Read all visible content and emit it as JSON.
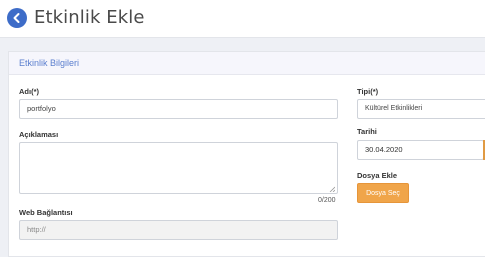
{
  "header": {
    "title": "Etkinlik Ekle",
    "back_icon": "arrow-left-circle-icon"
  },
  "card": {
    "title": "Etkinlik Bilgileri"
  },
  "form": {
    "name_label": "Adı(*)",
    "name_value": "portfolyo",
    "description_label": "Açıklaması",
    "description_value": "",
    "char_counter": "0/200",
    "web_label": "Web Bağlantısı",
    "web_placeholder": "http://",
    "type_label": "Tipi(*)",
    "type_value": "Kültürel Etkinlikleri",
    "date_label": "Tarihi",
    "date_value": "30.04.2020",
    "file_label": "Dosya Ekle",
    "file_button": "Dosya Seç"
  },
  "colors": {
    "accent_blue": "#3d6cc8",
    "title_blue": "#5b7fce",
    "button_orange": "#f0a54a"
  }
}
